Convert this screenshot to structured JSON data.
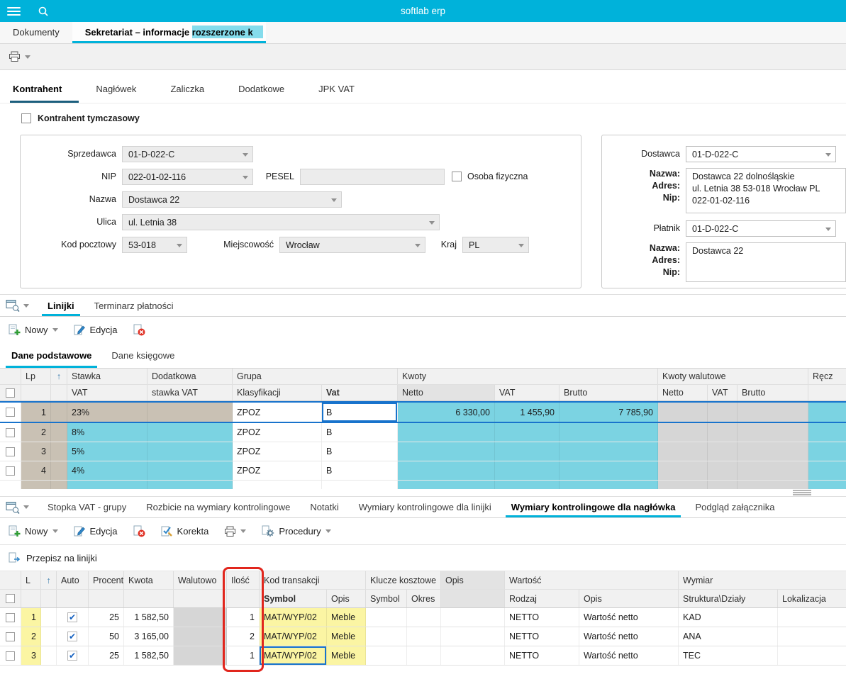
{
  "icons": {
    "sort_arrow": "↑",
    "check": "✔"
  },
  "topbar": {
    "title": "softlab erp"
  },
  "window_tabs": {
    "documents": "Dokumenty",
    "active": "Sekretariat – informacje rozszerzone k"
  },
  "main_tabs": {
    "t1": "Kontrahent",
    "t2": "Nagłówek",
    "t3": "Zaliczka",
    "t4": "Dodatkowe",
    "t5": "JPK VAT"
  },
  "form": {
    "temp_checkbox": "Kontrahent tymczasowy",
    "sprzedawca_label": "Sprzedawca",
    "sprzedawca_value": "01-D-022-C",
    "nip_label": "NIP",
    "nip_value": "022-01-02-116",
    "pesel_label": "PESEL",
    "pesel_value": "",
    "osoba_label": "Osoba fizyczna",
    "nazwa_label": "Nazwa",
    "nazwa_value": "Dostawca 22",
    "ulica_label": "Ulica",
    "ulica_value": "ul. Letnia 38",
    "kod_label": "Kod pocztowy",
    "kod_value": "53-018",
    "miejscowosc_label": "Miejscowość",
    "miejscowosc_value": "Wrocław",
    "kraj_label": "Kraj",
    "kraj_value": "PL"
  },
  "right_panel": {
    "dostawca_label": "Dostawca",
    "dostawca_value": "01-D-022-C",
    "info1_labels": [
      "Nazwa:",
      "Adres:",
      "Nip:"
    ],
    "info1_lines": [
      "Dostawca 22 dolnośląskie",
      "ul. Letnia 38 53-018 Wrocław PL",
      "022-01-02-116"
    ],
    "platnik_label": "Płatnik",
    "platnik_value": "01-D-022-C",
    "info2_labels": [
      "Nazwa:",
      "Adres:",
      "Nip:"
    ],
    "info2_lines": [
      "Dostawca 22"
    ]
  },
  "linijki": {
    "tabs": [
      "Linijki",
      "Terminarz płatności"
    ],
    "toolbar": {
      "nowy": "Nowy",
      "edycja": "Edycja"
    },
    "subtabs": [
      "Dane podstawowe",
      "Dane księgowe"
    ],
    "header": {
      "lp": "Lp",
      "stawka_l1": "Stawka",
      "stawka_l2": "VAT",
      "dodatkowa_l1": "Dodatkowa",
      "dodatkowa_l2": "stawka VAT",
      "grupa": "Grupa",
      "klasyfikacji": "Klasyfikacji",
      "vat": "Vat",
      "kwoty": "Kwoty",
      "netto": "Netto",
      "vat_kwota": "VAT",
      "brutto": "Brutto",
      "kwoty_walutowe": "Kwoty walutowe",
      "netto_w": "Netto",
      "vat_w": "VAT",
      "brutto_w": "Brutto",
      "recz": "Ręcz"
    },
    "rows": [
      {
        "lp": "1",
        "stawka": "23%",
        "klasyfikacja": "ZPOZ",
        "vat": "B",
        "netto": "6 330,00",
        "vat_kwota": "1 455,90",
        "brutto": "7 785,90"
      },
      {
        "lp": "2",
        "stawka": "8%",
        "klasyfikacja": "ZPOZ",
        "vat": "B",
        "netto": "",
        "vat_kwota": "",
        "brutto": ""
      },
      {
        "lp": "3",
        "stawka": "5%",
        "klasyfikacja": "ZPOZ",
        "vat": "B",
        "netto": "",
        "vat_kwota": "",
        "brutto": ""
      },
      {
        "lp": "4",
        "stawka": "4%",
        "klasyfikacja": "ZPOZ",
        "vat": "B",
        "netto": "",
        "vat_kwota": "",
        "brutto": ""
      }
    ]
  },
  "wymiary": {
    "tabs": [
      "Stopka VAT - grupy",
      "Rozbicie na wymiary kontrolingowe",
      "Notatki",
      "Wymiary kontrolingowe dla linijki",
      "Wymiary kontrolingowe dla nagłówka",
      "Podgląd załącznika"
    ],
    "toolbar": {
      "nowy": "Nowy",
      "edycja": "Edycja",
      "korekta": "Korekta",
      "procedury": "Procedury"
    },
    "przepisz": "Przepisz na linijki",
    "header": {
      "l": "L",
      "auto": "Auto",
      "procent": "Procent",
      "kwota": "Kwota",
      "walutowo": "Walutowo",
      "ilosc": "Ilość",
      "kod_transakcji": "Kod transakcji",
      "symbol1": "Symbol",
      "opis1": "Opis",
      "klucze_kosztowe": "Klucze kosztowe",
      "symbol2": "Symbol",
      "okres": "Okres",
      "opis_mid": "Opis",
      "wartosc": "Wartość",
      "rodzaj": "Rodzaj",
      "opis2": "Opis",
      "wymiar": "Wymiar",
      "struktura": "Struktura\\Działy",
      "lokalizacja": "Lokalizacja"
    },
    "rows": [
      {
        "l": "1",
        "procent": "25",
        "kwota": "1 582,50",
        "ilosc": "1",
        "symbol": "MAT/WYP/02",
        "opis": "Meble",
        "rodzaj": "NETTO",
        "opis_wartosci": "Wartość netto",
        "struktura": "KAD"
      },
      {
        "l": "2",
        "procent": "50",
        "kwota": "3 165,00",
        "ilosc": "2",
        "symbol": "MAT/WYP/02",
        "opis": "Meble",
        "rodzaj": "NETTO",
        "opis_wartosci": "Wartość netto",
        "struktura": "ANA"
      },
      {
        "l": "3",
        "procent": "25",
        "kwota": "1 582,50",
        "ilosc": "1",
        "symbol": "MAT/WYP/02",
        "opis": "Meble",
        "rodzaj": "NETTO",
        "opis_wartosci": "Wartość netto",
        "struktura": "TEC"
      }
    ]
  },
  "colors": {
    "accent": "#00b2da",
    "active_form_tab_underline": "#1b5e7d",
    "row_highlight": "#7bd3e2",
    "fixed_cell": "#c9c1b4",
    "disabled_cell": "#d6d6d6",
    "value_cell": "#fbf5a3",
    "focus_border": "#1873cc",
    "annotation": "#e1261d"
  }
}
